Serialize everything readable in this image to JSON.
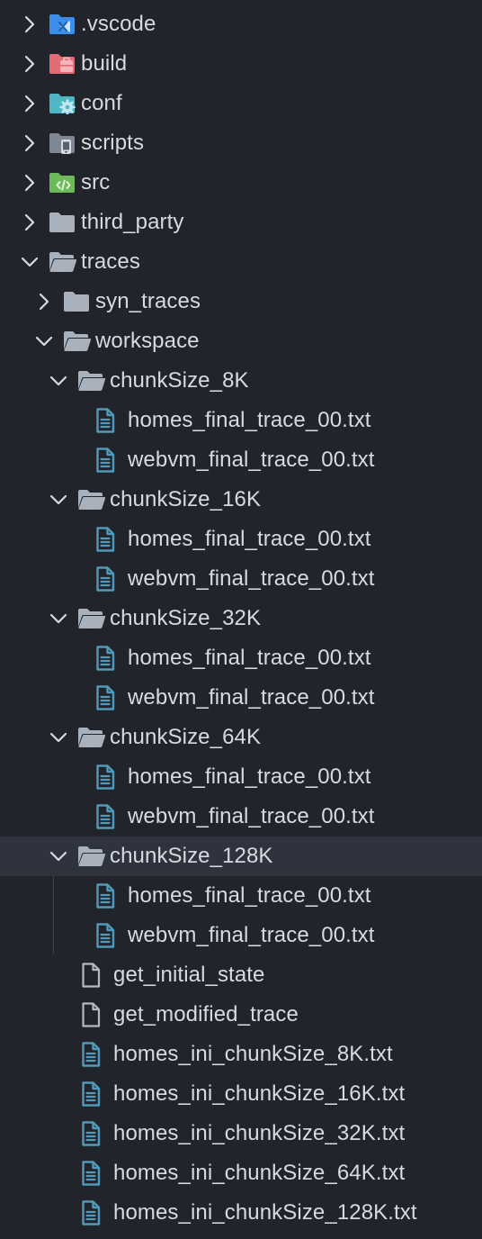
{
  "explorer": {
    "items": [
      {
        "label": ".vscode",
        "depth": 0,
        "kind": "folder",
        "icon": "vscode-folder-icon",
        "expanded": false
      },
      {
        "label": "build",
        "depth": 0,
        "kind": "folder",
        "icon": "build-folder-icon",
        "expanded": false
      },
      {
        "label": "conf",
        "depth": 0,
        "kind": "folder",
        "icon": "config-folder-icon",
        "expanded": false
      },
      {
        "label": "scripts",
        "depth": 0,
        "kind": "folder",
        "icon": "scripts-folder-icon",
        "expanded": false
      },
      {
        "label": "src",
        "depth": 0,
        "kind": "folder",
        "icon": "src-folder-icon",
        "expanded": false
      },
      {
        "label": "third_party",
        "depth": 0,
        "kind": "folder",
        "icon": "folder-icon",
        "expanded": false
      },
      {
        "label": "traces",
        "depth": 0,
        "kind": "folder",
        "icon": "folder-open-icon",
        "expanded": true
      },
      {
        "label": "syn_traces",
        "depth": 1,
        "kind": "folder",
        "icon": "folder-icon",
        "expanded": false
      },
      {
        "label": "workspace",
        "depth": 1,
        "kind": "folder",
        "icon": "folder-open-icon",
        "expanded": true
      },
      {
        "label": "chunkSize_8K",
        "depth": 2,
        "kind": "folder",
        "icon": "folder-open-icon",
        "expanded": true
      },
      {
        "label": "homes_final_trace_00.txt",
        "depth": 3,
        "kind": "file",
        "icon": "text-file-icon"
      },
      {
        "label": "webvm_final_trace_00.txt",
        "depth": 3,
        "kind": "file",
        "icon": "text-file-icon"
      },
      {
        "label": "chunkSize_16K",
        "depth": 2,
        "kind": "folder",
        "icon": "folder-open-icon",
        "expanded": true
      },
      {
        "label": "homes_final_trace_00.txt",
        "depth": 3,
        "kind": "file",
        "icon": "text-file-icon"
      },
      {
        "label": "webvm_final_trace_00.txt",
        "depth": 3,
        "kind": "file",
        "icon": "text-file-icon"
      },
      {
        "label": "chunkSize_32K",
        "depth": 2,
        "kind": "folder",
        "icon": "folder-open-icon",
        "expanded": true
      },
      {
        "label": "homes_final_trace_00.txt",
        "depth": 3,
        "kind": "file",
        "icon": "text-file-icon"
      },
      {
        "label": "webvm_final_trace_00.txt",
        "depth": 3,
        "kind": "file",
        "icon": "text-file-icon"
      },
      {
        "label": "chunkSize_64K",
        "depth": 2,
        "kind": "folder",
        "icon": "folder-open-icon",
        "expanded": true
      },
      {
        "label": "homes_final_trace_00.txt",
        "depth": 3,
        "kind": "file",
        "icon": "text-file-icon"
      },
      {
        "label": "webvm_final_trace_00.txt",
        "depth": 3,
        "kind": "file",
        "icon": "text-file-icon"
      },
      {
        "label": "chunkSize_128K",
        "depth": 2,
        "kind": "folder",
        "icon": "folder-open-icon",
        "expanded": true,
        "selected": true
      },
      {
        "label": "homes_final_trace_00.txt",
        "depth": 3,
        "kind": "file",
        "icon": "text-file-icon"
      },
      {
        "label": "webvm_final_trace_00.txt",
        "depth": 3,
        "kind": "file",
        "icon": "text-file-icon"
      },
      {
        "label": "get_initial_state",
        "depth": 2,
        "kind": "file",
        "icon": "blank-file-icon"
      },
      {
        "label": "get_modified_trace",
        "depth": 2,
        "kind": "file",
        "icon": "blank-file-icon"
      },
      {
        "label": "homes_ini_chunkSize_8K.txt",
        "depth": 2,
        "kind": "file",
        "icon": "text-file-icon"
      },
      {
        "label": "homes_ini_chunkSize_16K.txt",
        "depth": 2,
        "kind": "file",
        "icon": "text-file-icon"
      },
      {
        "label": "homes_ini_chunkSize_32K.txt",
        "depth": 2,
        "kind": "file",
        "icon": "text-file-icon"
      },
      {
        "label": "homes_ini_chunkSize_64K.txt",
        "depth": 2,
        "kind": "file",
        "icon": "text-file-icon"
      },
      {
        "label": "homes_ini_chunkSize_128K.txt",
        "depth": 2,
        "kind": "file",
        "icon": "text-file-icon"
      }
    ]
  },
  "colors": {
    "background": "#21252b",
    "selected_row": "#2f333d",
    "text": "#d7dae0",
    "chevron": "#d7dae0",
    "folder": "#a9b1bd",
    "file_blue": "#519aba",
    "vscode_blue": "#3b8eea",
    "build_red": "#e06c75",
    "config_teal": "#4fb6c4",
    "src_green": "#6cba5a"
  }
}
